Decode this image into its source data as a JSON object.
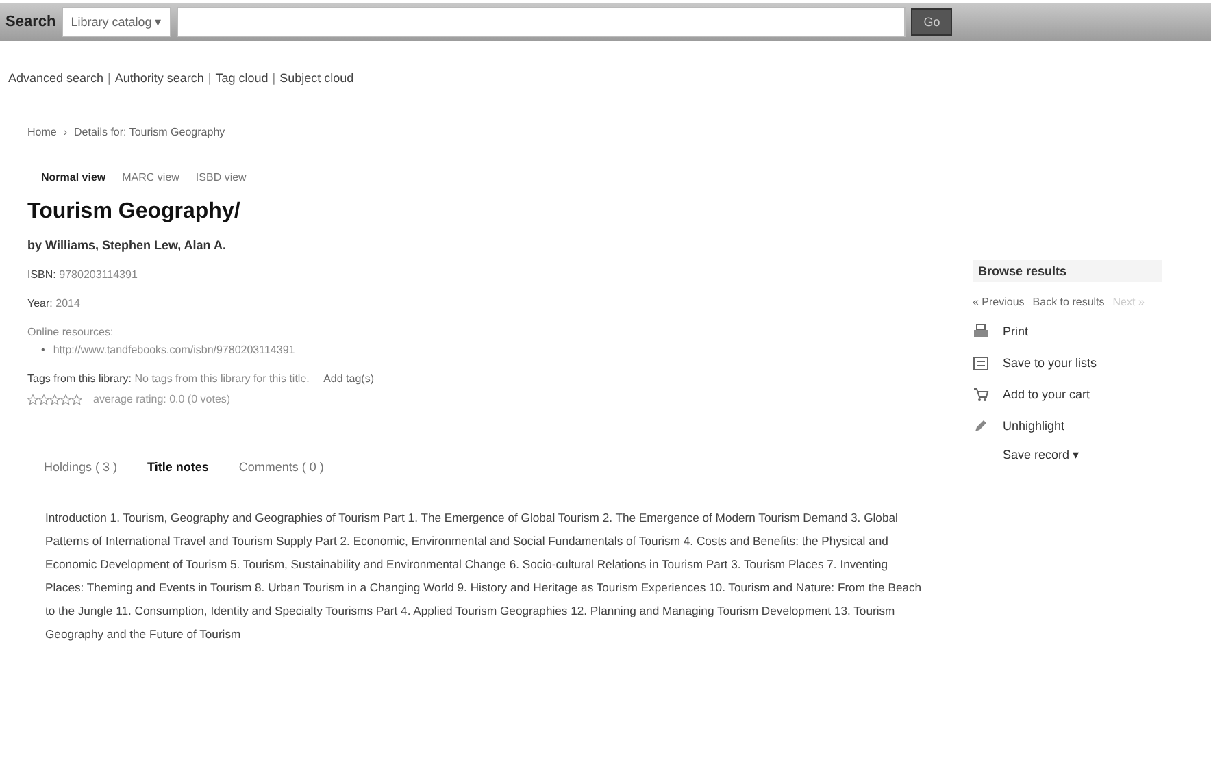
{
  "search_bar": {
    "label": "Search",
    "scope": "Library catalog",
    "scope_caret": "▾",
    "button": "Go"
  },
  "links": [
    {
      "kind": "link",
      "label": "Advanced search"
    },
    {
      "kind": "sep",
      "label": "|"
    },
    {
      "kind": "link",
      "label": "Authority search"
    },
    {
      "kind": "sep",
      "label": "|"
    },
    {
      "kind": "link",
      "label": "Tag cloud"
    },
    {
      "kind": "sep",
      "label": "|"
    },
    {
      "kind": "link",
      "label": "Subject cloud"
    }
  ],
  "breadcrumb": [
    {
      "label": "Home"
    },
    {
      "label": "›"
    },
    {
      "label": "Details for: Tourism Geography"
    }
  ],
  "views": [
    {
      "label": "Normal view",
      "selected": true
    },
    {
      "label": "MARC view",
      "selected": false
    },
    {
      "label": "ISBD view",
      "selected": false
    }
  ],
  "record": {
    "title": "Tourism Geography/",
    "author_label": "by",
    "authors": "Williams, Stephen Lew, Alan A.",
    "fields": [
      {
        "label": "ISBN:",
        "value": "9780203114391"
      },
      {
        "label": "Year:",
        "value": "2014"
      }
    ],
    "online_label": "Online resources:",
    "online_links": [
      {
        "bullet": "•",
        "url": "http://www.tandfebooks.com/isbn/9780203114391"
      }
    ],
    "tags_label": "Tags from this library:",
    "tags_text": "No tags from this library for this title.",
    "add_tag": "Add tag(s)",
    "stars": 0,
    "rating_text": "average rating: 0.0 (0 votes)"
  },
  "tabs": [
    {
      "label": "Holdings ( 3 )",
      "selected": false
    },
    {
      "label": "Title notes",
      "selected": true
    },
    {
      "label": "Comments ( 0 )",
      "selected": false
    }
  ],
  "notes": "Introduction 1. Tourism, Geography and Geographies of Tourism Part 1. The Emergence of Global Tourism 2. The Emergence of Modern Tourism Demand 3. Global Patterns of International Travel and Tourism Supply Part 2. Economic, Environmental and Social Fundamentals of Tourism 4. Costs and Benefits: the Physical and Economic Development of Tourism 5. Tourism, Sustainability and Environmental Change 6. Socio-cultural Relations in Tourism Part 3. Tourism Places 7. Inventing Places: Theming and Events in Tourism 8. Urban Tourism in a Changing World 9. History and Heritage as Tourism Experiences 10. Tourism and Nature: From the Beach to the Jungle 11. Consumption, Identity and Specialty Tourisms Part 4. Applied Tourism Geographies 12. Planning and Managing Tourism Development 13. Tourism Geography and the Future of Tourism",
  "sidebar": {
    "browse": "Browse results",
    "nav": [
      {
        "label": "« Previous",
        "disabled": false
      },
      {
        "label": "Back to results",
        "disabled": false
      },
      {
        "label": "Next »",
        "disabled": true
      }
    ],
    "actions": [
      {
        "kind": "print",
        "label": "Print"
      },
      {
        "kind": "list",
        "label": "Save to your lists"
      },
      {
        "kind": "cart",
        "label": "Add to your cart"
      },
      {
        "kind": "highlight",
        "label": "Unhighlight"
      }
    ],
    "save_record": "Save record",
    "save_caret": "▾"
  }
}
